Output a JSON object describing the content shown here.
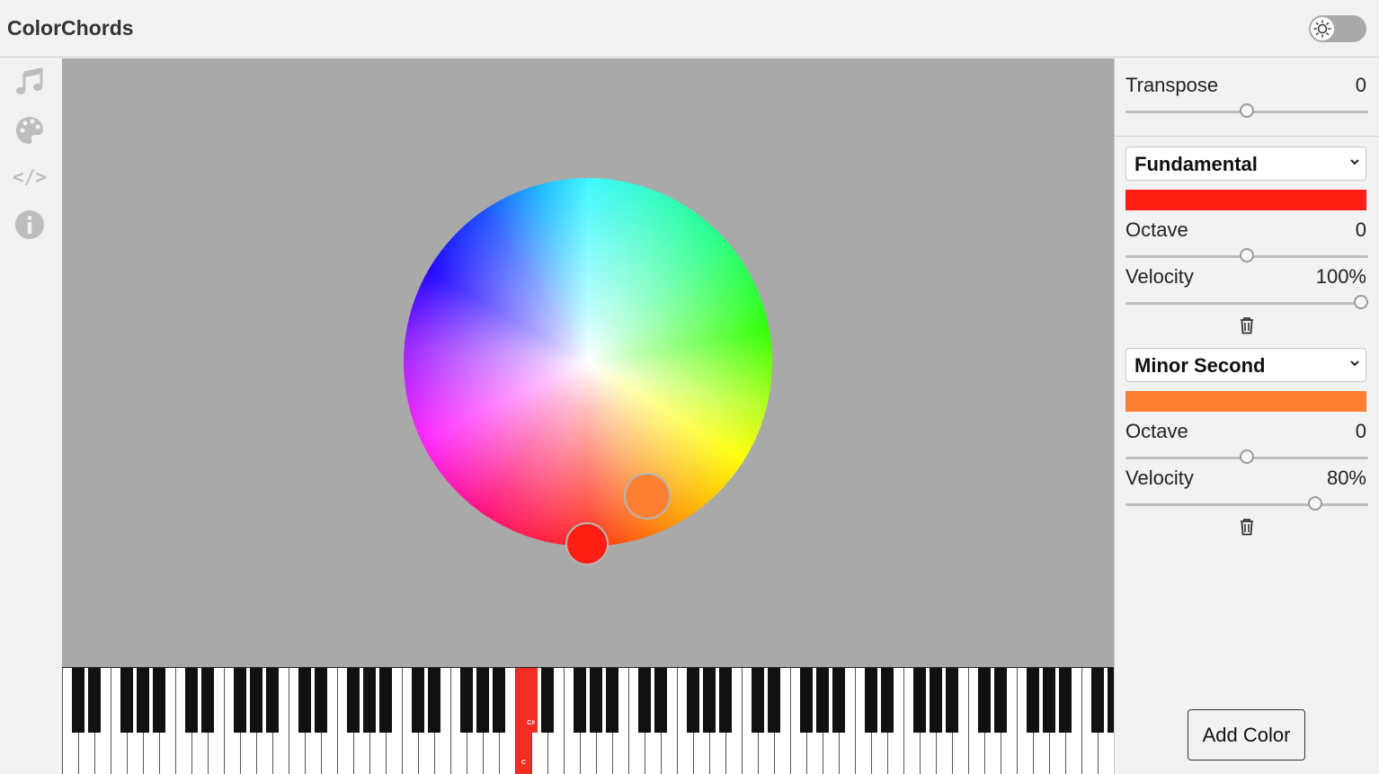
{
  "app": {
    "title": "ColorChords"
  },
  "theme_toggle": {
    "icon": "sun-icon",
    "state": "off"
  },
  "sidebar": {
    "items": [
      {
        "icon": "music-note-icon"
      },
      {
        "icon": "palette-icon"
      },
      {
        "icon": "code-icon",
        "label": "</>"
      },
      {
        "icon": "info-icon"
      }
    ]
  },
  "canvas": {
    "background": "#a9a9a9"
  },
  "keyboard": {
    "highlighted_white_key_label": "C",
    "highlighted_black_key_label": "C#",
    "highlight_color": "#f42d24"
  },
  "panel": {
    "transpose": {
      "label": "Transpose",
      "value": "0",
      "level": 0.5
    },
    "notes": [
      {
        "interval": "Fundamental",
        "color": "#ff1f14",
        "octave_label": "Octave",
        "octave": "0",
        "octave_level": 0.5,
        "velocity_label": "Velocity",
        "velocity": "100%",
        "velocity_level": 1.0
      },
      {
        "interval": "Minor Second",
        "color": "#ff7f32",
        "octave_label": "Octave",
        "octave": "0",
        "octave_level": 0.5,
        "velocity_label": "Velocity",
        "velocity": "80%",
        "velocity_level": 0.8
      }
    ],
    "add_color_label": "Add Color"
  }
}
